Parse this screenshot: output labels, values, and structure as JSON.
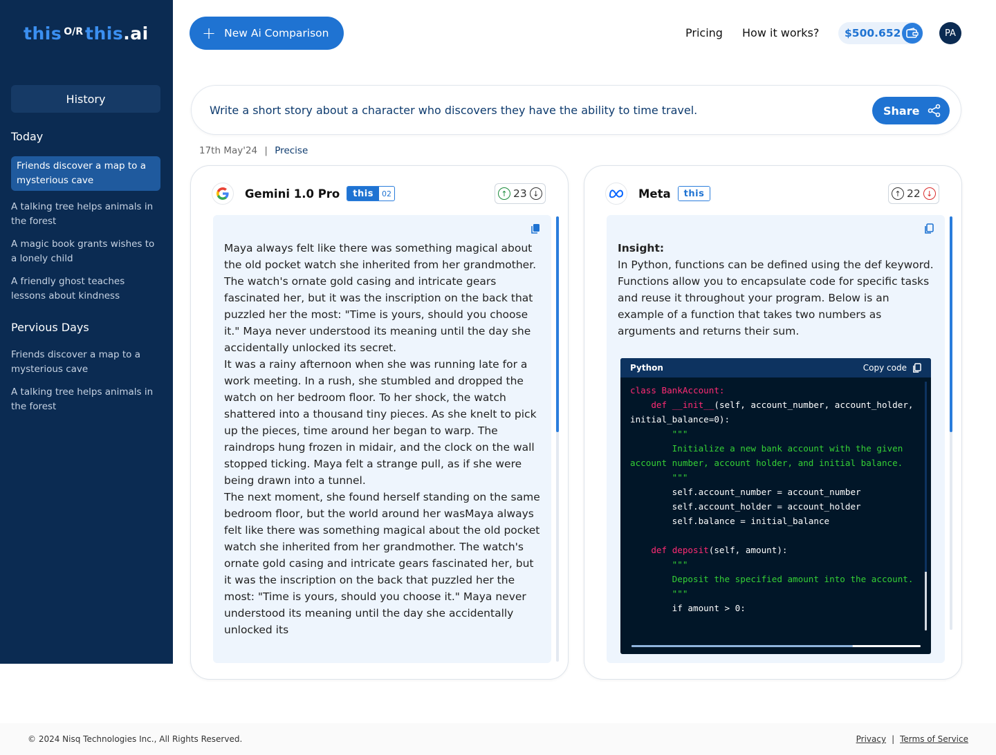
{
  "logo": {
    "left": "this",
    "or": "O/R",
    "right": "this",
    "tld": ".ai"
  },
  "sidebar": {
    "history_label": "History",
    "today_title": "Today",
    "today_items": [
      "Friends discover a map to a mysterious cave",
      "A talking tree helps animals in the forest",
      "A magic book grants wishes to a lonely child",
      "A friendly ghost teaches lessons about kindness"
    ],
    "previous_title": "Pervious Days",
    "previous_items": [
      "Friends discover a map to a mysterious cave",
      "A talking tree helps animals in the forest"
    ]
  },
  "header": {
    "new_button": "New Ai Comparison",
    "nav": [
      "Pricing",
      "How it works?"
    ],
    "credits": "$500.652",
    "avatar": "PA"
  },
  "prompt": {
    "text": "Write a short story about a character who discovers they have the ability to time travel.",
    "share_label": "Share",
    "date": "17th May'24",
    "separator": "|",
    "mode": "Precise"
  },
  "cards": [
    {
      "model": "Gemini 1.0 Pro",
      "badge": "this",
      "badge_count": "02",
      "votes": "23",
      "response": "Maya always felt like there was something magical about the old pocket watch she inherited from her grandmother. The watch's ornate gold casing and intricate gears fascinated her, but it was the inscription on the back that puzzled her the most: \"Time is yours, should you choose it.\" Maya never understood its meaning until the day she accidentally unlocked its secret.\nIt was a rainy afternoon when she was running late for a work meeting. In a rush, she stumbled and dropped the watch on her bedroom floor. To her shock, the watch shattered into a thousand tiny pieces. As she knelt to pick up the pieces, time around her began to warp. The raindrops hung frozen in midair, and the clock on the wall stopped ticking. Maya felt a strange pull, as if she were being drawn into a tunnel.\nThe next moment, she found herself standing on the same bedroom floor, but the world around her wasMaya always felt like there was something magical about the old pocket watch she inherited from her grandmother. The watch's ornate gold casing and intricate gears fascinated her, but it was the inscription on the back that puzzled her the most: \"Time is yours, should you choose it.\" Maya never understood its meaning until the day she accidentally unlocked its"
    },
    {
      "model": "Meta",
      "badge": "this",
      "votes": "22",
      "insight_title": "Insight:",
      "insight_text": "In Python, functions can be defined using the def keyword. Functions allow you to encapsulate code for specific tasks and reuse it throughout your program. Below is an example of a function that takes two numbers as arguments and returns their sum.",
      "code_lang": "Python",
      "copy_code": "Copy code"
    }
  ],
  "footer": {
    "copyright": "© 2024 Nisq Technologies Inc., All Rights Reserved.",
    "privacy": "Privacy",
    "sep": "|",
    "terms": "Terms of Service"
  },
  "colors": {
    "sidebar": "#0b2b52",
    "accent": "#1f73d2",
    "code_bg": "#011628",
    "upvote": "#1a8a3a",
    "downvote": "#d92b2b"
  }
}
